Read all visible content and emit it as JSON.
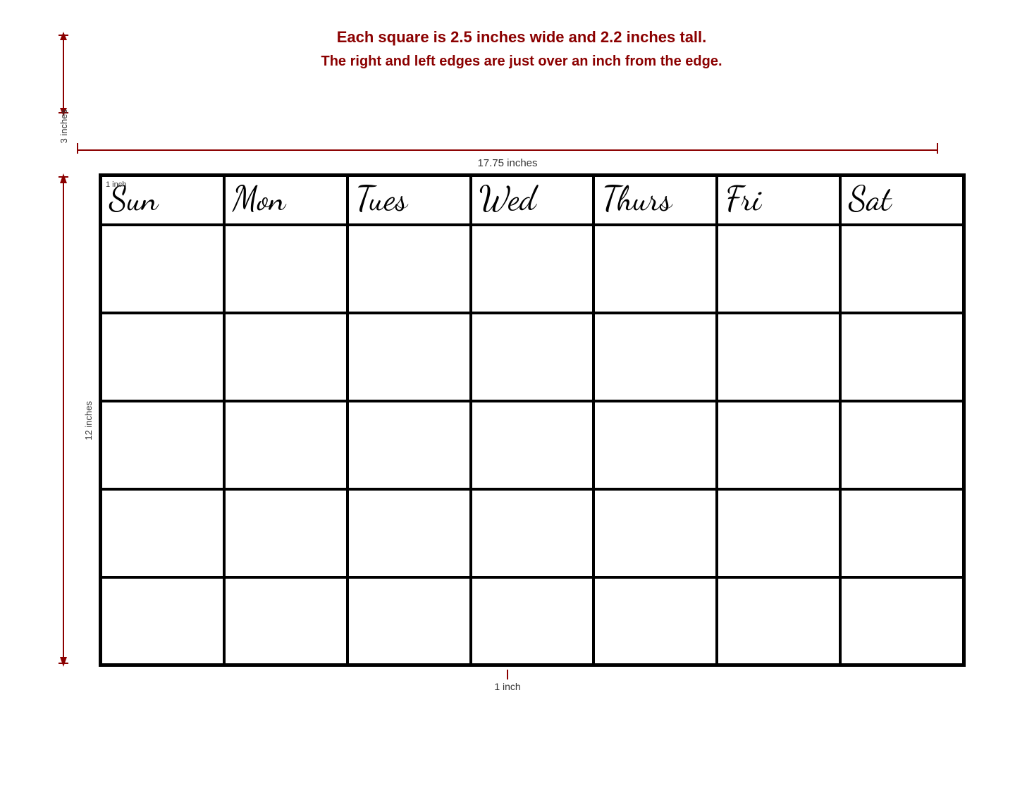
{
  "info": {
    "line1": "Each square is 2.5 inches wide and 2.2 inches tall.",
    "line2": "The right and left edges are just over an inch from the edge."
  },
  "measurements": {
    "top_width": "17.75 inches",
    "left_top": "3 inches",
    "left_main": "12 inches",
    "bottom_center": "1 inch",
    "corner_label": "1 inch"
  },
  "days": [
    "Sun",
    "Mon",
    "Tues",
    "Wed",
    "Thurs",
    "Fri",
    "Sat"
  ],
  "rows": 5
}
